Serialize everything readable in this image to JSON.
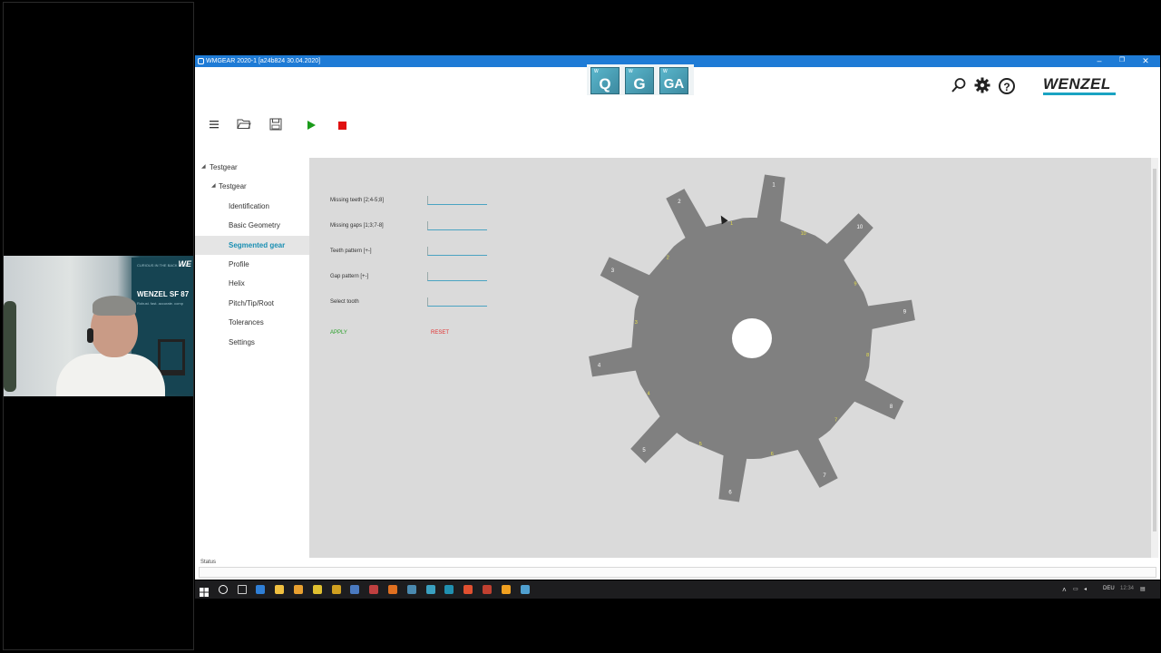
{
  "window": {
    "title": "WMGEAR 2020-1 [a24b824 30.04.2020]",
    "minimize": "–",
    "restore": "❐",
    "close": "✕"
  },
  "modes": [
    {
      "mini": "W",
      "letter": "Q"
    },
    {
      "mini": "W",
      "letter": "G"
    },
    {
      "mini": "W",
      "letter": "GA"
    }
  ],
  "header": {
    "brand": "WENZEL",
    "icons": [
      "search-icon",
      "gear-icon",
      "help-icon"
    ],
    "help_glyph": "?"
  },
  "toolbar": {
    "icons": [
      "menu-icon",
      "folder-open-icon",
      "save-icon",
      "play-icon",
      "stop-icon"
    ]
  },
  "tree": [
    {
      "label": "Testgear",
      "level": 0,
      "expanded": true
    },
    {
      "label": "Testgear",
      "level": 1,
      "expanded": true
    },
    {
      "label": "Identification",
      "level": 2
    },
    {
      "label": "Basic Geometry",
      "level": 2
    },
    {
      "label": "Segmented gear",
      "level": 2,
      "active": true
    },
    {
      "label": "Profile",
      "level": 2
    },
    {
      "label": "Helix",
      "level": 2
    },
    {
      "label": "Pitch/Tip/Root",
      "level": 2
    },
    {
      "label": "Tolerances",
      "level": 2
    },
    {
      "label": "Settings",
      "level": 2
    }
  ],
  "form": {
    "fields": [
      {
        "label": "Missing teeth  [2;4-5;8]",
        "value": ""
      },
      {
        "label": "Missing gaps  [1;3;7-8]",
        "value": ""
      },
      {
        "label": "Teeth pattern [+-]",
        "value": ""
      },
      {
        "label": "Gap pattern [+-]",
        "value": ""
      },
      {
        "label": "Select tooth",
        "value": ""
      }
    ],
    "apply": "APPLY",
    "reset": "RESET"
  },
  "gear": {
    "teeth_count": 10,
    "tooth_labels": [
      "1",
      "10",
      "9",
      "8",
      "7",
      "6",
      "5",
      "4",
      "3",
      "2"
    ],
    "gap_labels": [
      "1",
      "10",
      "9",
      "8",
      "7",
      "6",
      "5",
      "4",
      "3",
      "2"
    ],
    "colors": {
      "body": "#808080",
      "tooth_label": "#ffffff",
      "gap_label": "#e8e04a",
      "bore": "#ffffff"
    }
  },
  "status": {
    "label": "Status",
    "text": ""
  },
  "webcam": {
    "banner_top": "CURIOUS IN THE BACK LOOK",
    "banner_title": "WENZEL SF 87",
    "banner_sub": "Robust. fast. accurate. comp",
    "logo_fragment": "WE"
  },
  "taskbar": {
    "icons": [
      "windows-start-icon",
      "search-icon",
      "task-view-icon",
      "edge-icon",
      "explorer-icon",
      "folder-icon",
      "app-icon",
      "app-icon",
      "app-icon",
      "app-icon",
      "app-icon",
      "app-icon",
      "app-icon",
      "app-icon",
      "app-icon",
      "app-icon",
      "app-icon",
      "app-icon"
    ],
    "tray": {
      "language": "DEU",
      "clock": "12:34"
    }
  }
}
